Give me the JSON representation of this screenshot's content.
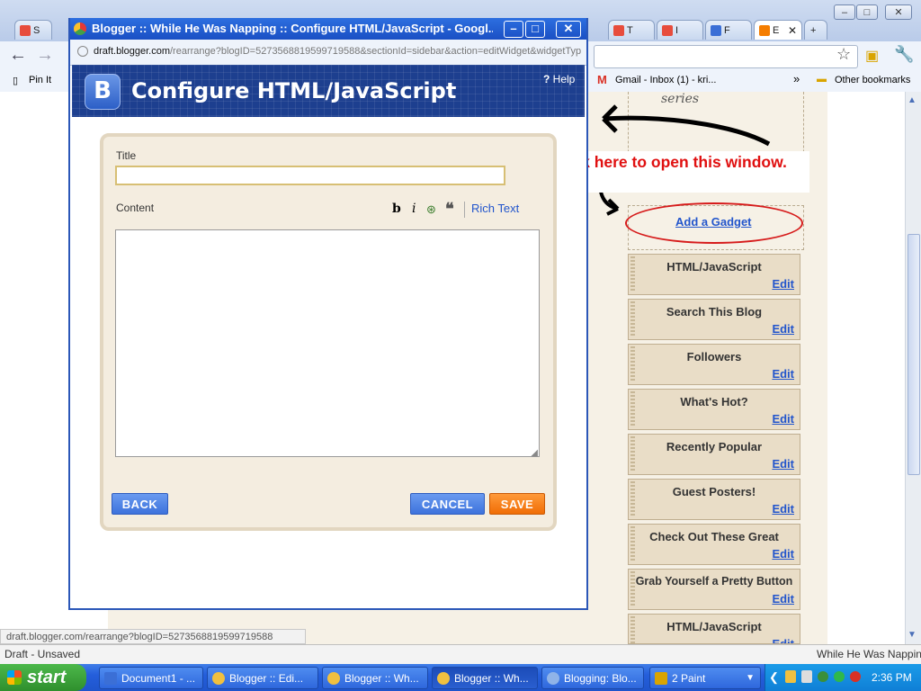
{
  "browser": {
    "tabs": [
      {
        "label": "S"
      },
      {
        "label": "T"
      },
      {
        "label": "I"
      },
      {
        "label": "F"
      },
      {
        "label": "E",
        "active": true
      }
    ],
    "bookmarks": {
      "pin_it": "Pin It",
      "gmail": "Gmail - Inbox (1) - kri...",
      "more": "»",
      "other": "Other bookmarks"
    },
    "status_url": "draft.blogger.com/rearrange?blogID=5273568819599719588",
    "draft_status": "Draft - Unsaved",
    "blog_name_right": "While He Was Napping"
  },
  "popup": {
    "window_title": "Blogger :: While He Was Napping :: Configure HTML/JavaScript - Googl...",
    "url_domain": "draft.blogger.com",
    "url_path": "/rearrange?blogID=5273568819599719588&sectionId=sidebar&action=editWidget&widgetTyp",
    "help_label": "Help",
    "dialog_title": "Configure HTML/JavaScript",
    "title_label": "Title",
    "title_value": "",
    "content_label": "Content",
    "rich_text_link": "Rich Text",
    "content_value": "",
    "back_button": "BACK",
    "cancel_button": "CANCEL",
    "save_button": "SAVE"
  },
  "annotation": {
    "text": "Click here to open this window."
  },
  "sidebar": {
    "script_text": "series",
    "add_gadget": "Add a Gadget",
    "edit_label": "Edit",
    "gadgets": [
      {
        "title": "HTML/JavaScript"
      },
      {
        "title": "Search This Blog"
      },
      {
        "title": "Followers"
      },
      {
        "title": "What's Hot?"
      },
      {
        "title": "Recently Popular"
      },
      {
        "title": "Guest Posters!"
      },
      {
        "title": "Check Out These Great"
      },
      {
        "title": "Grab Yourself a Pretty Button"
      },
      {
        "title": "HTML/JavaScript"
      }
    ]
  },
  "taskbar": {
    "start": "start",
    "items": [
      {
        "label": "Document1 - ..."
      },
      {
        "label": "Blogger :: Edi..."
      },
      {
        "label": "Blogger :: Wh..."
      },
      {
        "label": "Blogger :: Wh...",
        "active": true
      },
      {
        "label": "Blogging: Blo..."
      },
      {
        "label": "2 Paint"
      }
    ],
    "clock": "2:36 PM"
  },
  "colors": {
    "accent_blue": "#1d3f8f",
    "save_orange": "#f06d05",
    "annotation_red": "#e01010",
    "link_blue": "#2255cc"
  }
}
